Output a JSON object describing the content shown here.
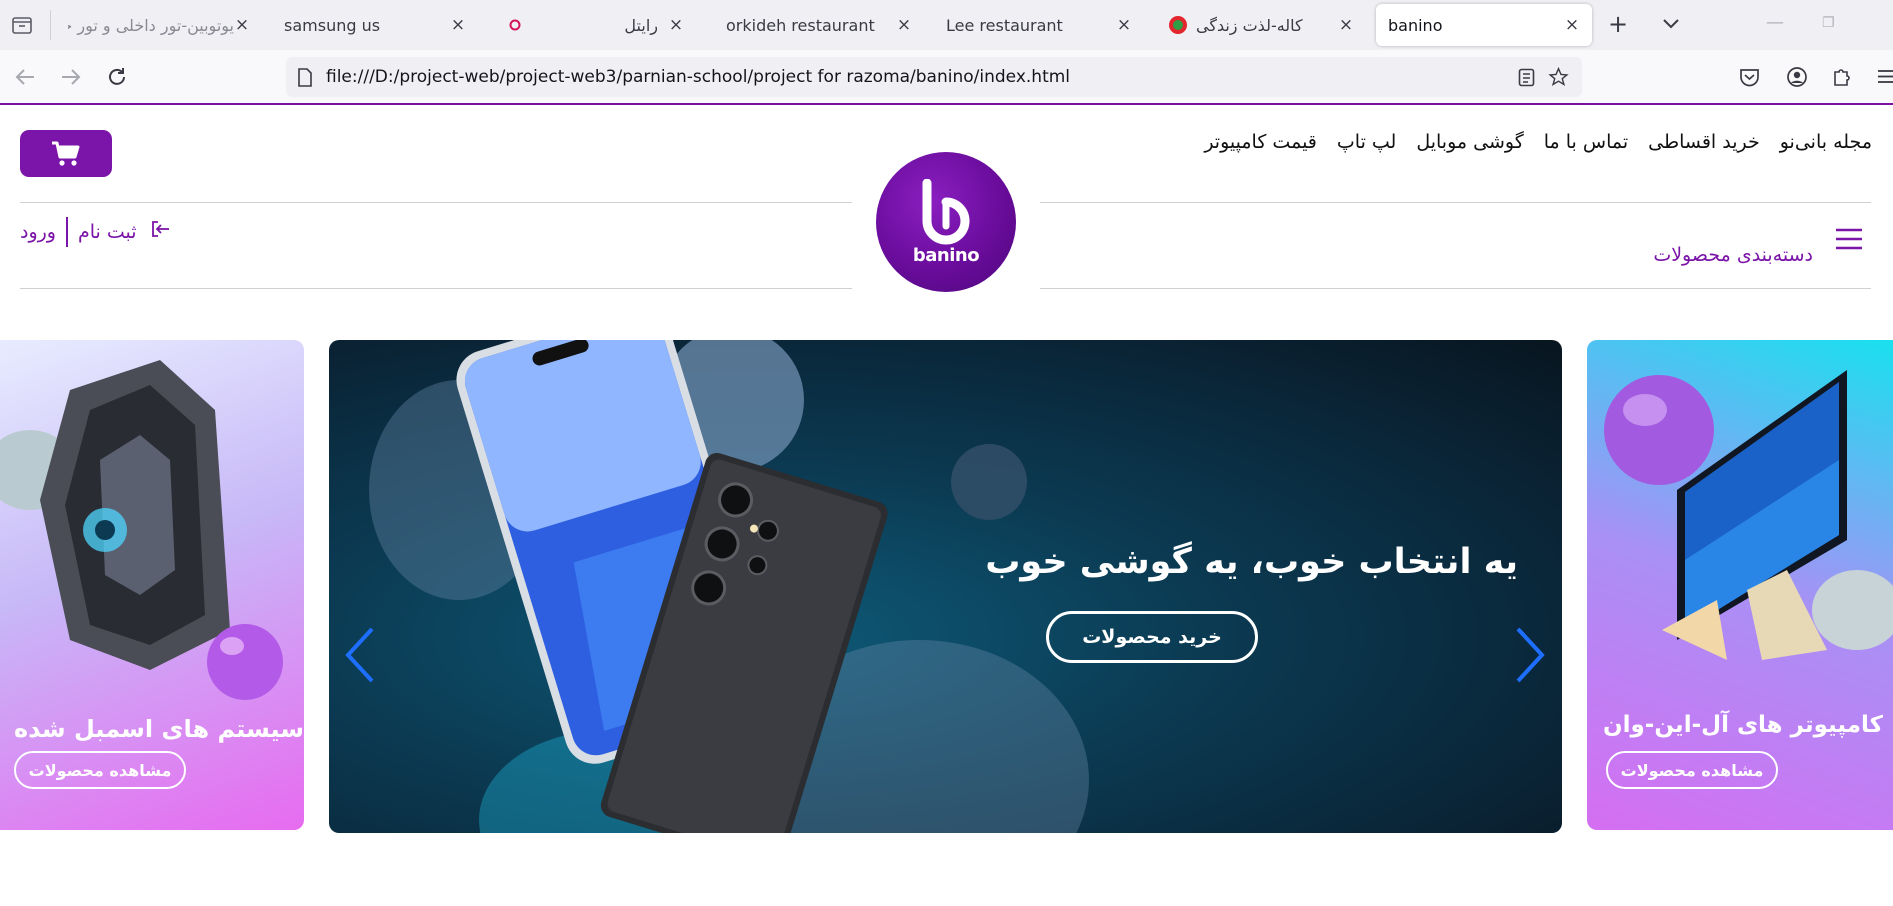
{
  "browser": {
    "tabs": [
      {
        "title": "یوتوبین-تور داخلی و تور خا",
        "active": false
      },
      {
        "title": "samsung us",
        "active": false
      },
      {
        "title": "",
        "active": false
      },
      {
        "title": "رایتل",
        "active": false
      },
      {
        "title": "orkideh restaurant",
        "active": false
      },
      {
        "title": "Lee restaurant",
        "active": false
      },
      {
        "title": "کاله-لذت زندگی",
        "active": false
      },
      {
        "title": "banino",
        "active": true
      }
    ],
    "url": "file:///D:/project-web/project-web3/parnian-school/project for razoma/banino/index.html",
    "accent_color": "#7b0fa0"
  },
  "header": {
    "top_links": [
      "قیمت کامپیوتر",
      "لپ تاپ",
      "گوشی موبایل",
      "تماس با ما",
      "خرید اقساطی",
      "مجله بانی‌نو"
    ],
    "logo_text": "banino",
    "login_label": "ورود",
    "register_label": "ثبت نام",
    "categories_label": "دسته‌بندی محصولات",
    "brand_color": "#7b14a8"
  },
  "slider": {
    "main": {
      "title": "یه انتخاب خوب، یه گوشی خوب",
      "button_label": "خرید محصولات"
    },
    "left": {
      "title": "سیستم های اسمبل شده",
      "button_label": "مشاهده محصولات"
    },
    "right": {
      "title": "کامپیوتر های آل-این-وان",
      "button_label": "مشاهده محصولات"
    },
    "arrow_color": "#1e6fff"
  }
}
